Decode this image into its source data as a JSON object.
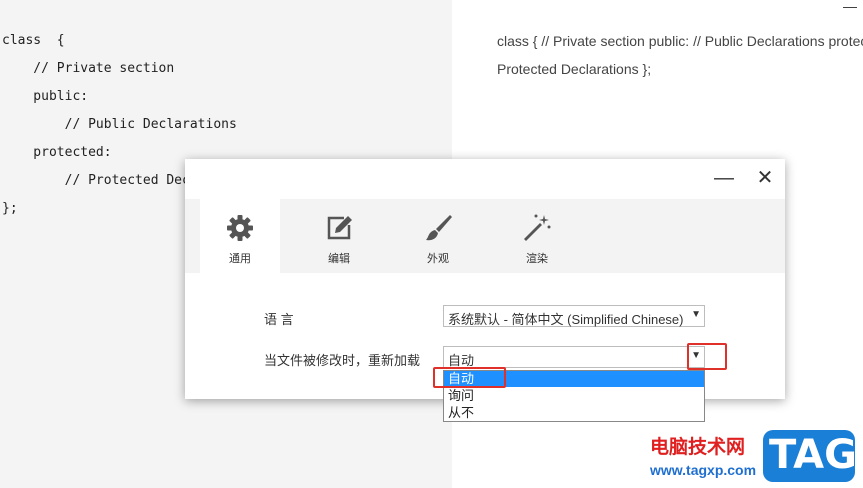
{
  "editor": {
    "lines": [
      "class  {",
      "    // Private section",
      "    public:",
      "        // Public Declarations",
      "    protected:",
      "        // Protected Declarations",
      "};"
    ]
  },
  "preview": {
    "lines": [
      "class { // Private section public: // Public Declarations protected: //",
      "Protected Declarations };"
    ],
    "minimize_symbol": "—"
  },
  "dialog": {
    "minimize_symbol": "—",
    "close_symbol": "✕",
    "tabs": [
      {
        "label": "通用",
        "icon": "gear-icon",
        "active": true
      },
      {
        "label": "编辑",
        "icon": "edit-icon",
        "active": false
      },
      {
        "label": "外观",
        "icon": "brush-icon",
        "active": false
      },
      {
        "label": "渲染",
        "icon": "magic-wand-icon",
        "active": false
      }
    ],
    "language_label": "语 言",
    "language_value": "系统默认 - 简体中文 (Simplified Chinese)",
    "reload_label": "当文件被修改时，重新加载",
    "reload_value": "自动",
    "dropdown_arrow": "▼",
    "reload_options": [
      "自动",
      "询问",
      "从不"
    ],
    "selected_option": "自动",
    "selection_color": "#1e90ff"
  },
  "annotations": {
    "highlight_color": "#e0302a"
  },
  "watermark": {
    "site_name": "电脑技术网",
    "url": "www.tagxp.com",
    "badge": "TAG",
    "text_color": "#e02020",
    "badge_color": "#1a7fd6"
  }
}
